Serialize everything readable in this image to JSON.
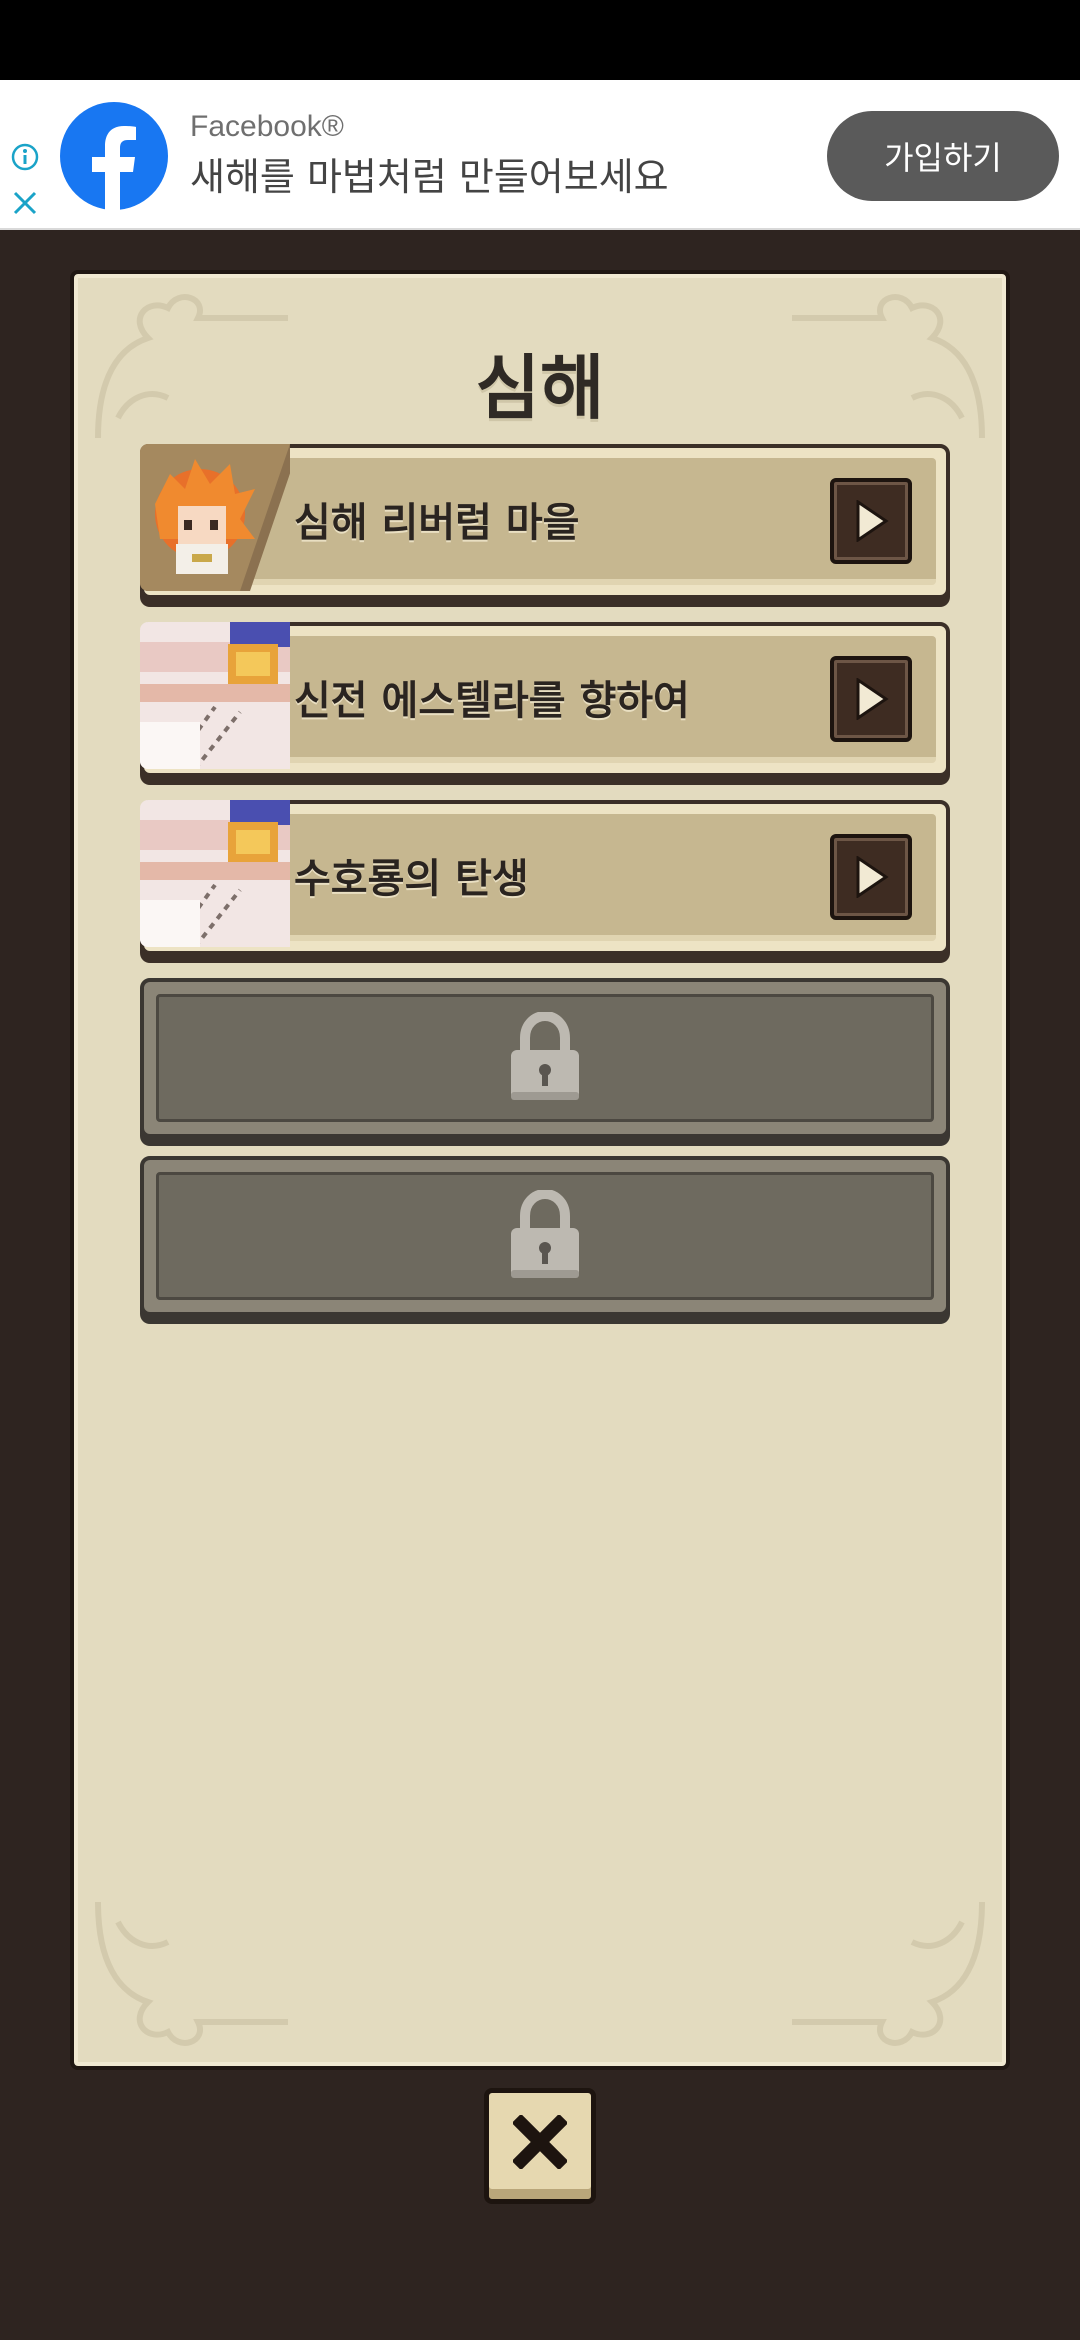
{
  "ad": {
    "advertiser": "Facebook®",
    "headline": "새해를 마법처럼 만들어보세요",
    "cta": "가입하기",
    "brand_color": "#1877f2"
  },
  "dialog": {
    "title": "심해",
    "stages": [
      {
        "label": "심해 리버럼 마을",
        "thumbnail": "orange-hair-character",
        "locked": false
      },
      {
        "label": "신전 에스텔라를 향하여",
        "thumbnail": "sky-lantern-scene",
        "locked": false
      },
      {
        "label": "수호룡의 탄생",
        "thumbnail": "sky-lantern-scene",
        "locked": false
      },
      {
        "label": "",
        "icon": "lock-icon",
        "locked": true
      },
      {
        "label": "",
        "icon": "lock-icon",
        "locked": true
      }
    ]
  },
  "close_icon": "close-x-icon"
}
